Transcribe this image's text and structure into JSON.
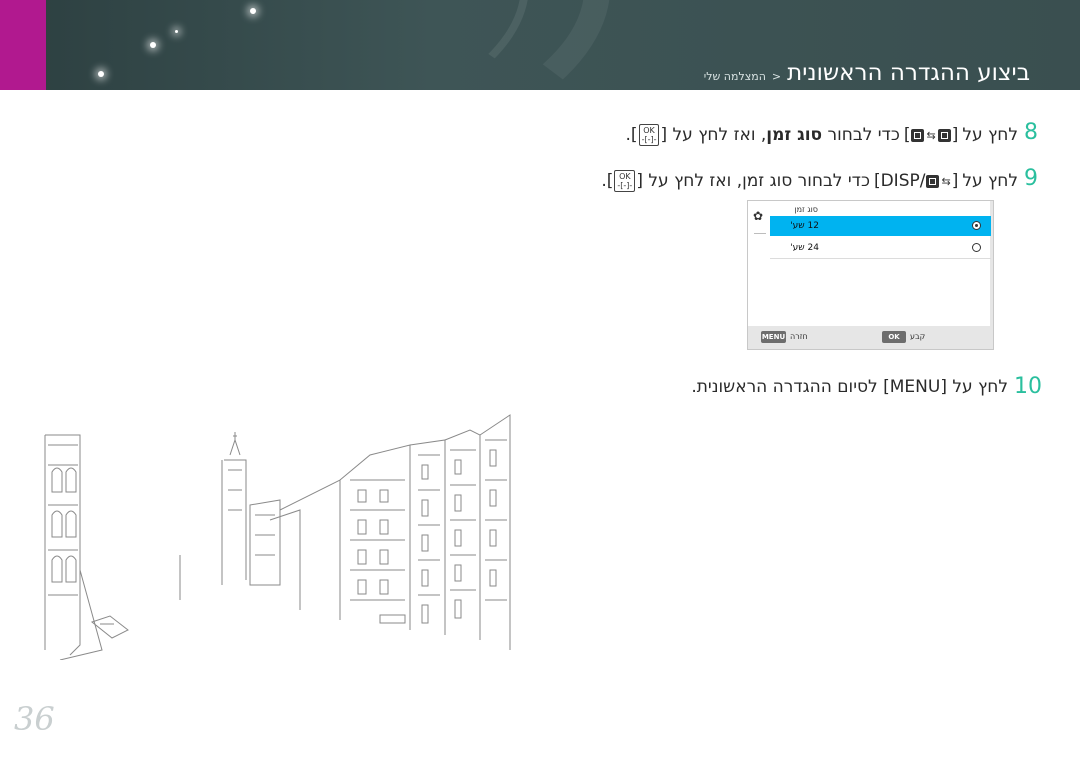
{
  "header": {
    "section": "המצלמה שלי",
    "separator": "<",
    "title": "ביצוע ההגדרה הראשונית"
  },
  "steps": [
    {
      "number": "8",
      "text_a": "לחץ על",
      "text_b": "כדי לבחור",
      "text_bold": "סוג זמן",
      "text_c": ", ואז לחץ על",
      "text_d": "."
    },
    {
      "number": "9",
      "text_a": "לחץ על",
      "disp": "DISP",
      "text_b": "כדי לבחור סוג זמן, ואז לחץ על",
      "text_d": "."
    },
    {
      "number": "10",
      "text": "לחץ על [MENU] לסיום ההגדרה הראשונית."
    }
  ],
  "icons": {
    "ok_icon_top": "OK",
    "ok_icon_bottom": "-[-]-",
    "menu_key": "MENU",
    "ok_key": "OK"
  },
  "camera_screen": {
    "header": "סוג זמן",
    "options": [
      {
        "label": "12 שע'",
        "selected": true
      },
      {
        "label": "24 שע'",
        "selected": false
      }
    ],
    "footer_back": "חזרה",
    "footer_set": "קבע"
  },
  "page_number": "36",
  "colors": {
    "header_bg": "#3a4f50",
    "accent_magenta": "#b1198f",
    "step_number": "#2abf9e",
    "selection": "#00b3f0"
  }
}
